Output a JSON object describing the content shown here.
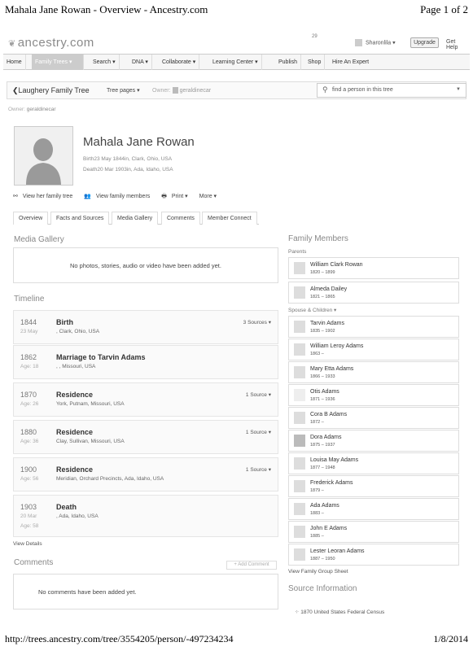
{
  "print": {
    "header_title": "Mahala Jane Rowan - Overview - Ancestry.com",
    "page_of": "Page 1 of 2",
    "footer_url": "http://trees.ancestry.com/tree/3554205/person/-497234234",
    "footer_date": "1/8/2014"
  },
  "topbar": {
    "logo": "ancestry.com",
    "notification_count": "29",
    "user": "Sharonlila ▾",
    "upgrade": "Upgrade",
    "help": "Get Help"
  },
  "nav": {
    "items": [
      "Home",
      "Family Trees ▾",
      "Search ▾",
      "DNA ▾",
      "Collaborate ▾",
      "Learning Center ▾",
      "Publish",
      "Shop",
      "Hire An Expert"
    ]
  },
  "treebar": {
    "back": "❮Laughery Family Tree",
    "tree_pages": "Tree pages ▾",
    "owner_label": "Owner:",
    "owner_name": "geraldinecar",
    "find_placeholder": "find a person in this tree"
  },
  "owner_line": {
    "label": "Owner:",
    "name": "geraldinecar"
  },
  "person": {
    "name": "Mahala Jane Rowan",
    "birth": "Birth23 May 1844in, Clark, Ohio, USA",
    "death": "Death20 Mar 1903in, Ada, Idaho, USA"
  },
  "actions": [
    "View her family tree",
    "View family members",
    "Print ▾",
    "More ▾"
  ],
  "tabs": [
    "Overview",
    "Facts and Sources",
    "Media Gallery",
    "Comments",
    "Member Connect"
  ],
  "media": {
    "title": "Media Gallery",
    "empty": "No photos, stories, audio or video have been added yet."
  },
  "timeline": {
    "title": "Timeline",
    "events": [
      {
        "year": "1844",
        "sub": "23 May",
        "event": "Birth",
        "place": ", Clark, Ohio, USA",
        "sources": "3 Sources ▾"
      },
      {
        "year": "1862",
        "sub": "Age: 18",
        "event": "Marriage to Tarvin Adams",
        "place": ", , Missouri, USA",
        "sources": ""
      },
      {
        "year": "1870",
        "sub": "Age: 26",
        "event": "Residence",
        "place": "York, Putnam, Missouri, USA",
        "sources": "1 Source ▾"
      },
      {
        "year": "1880",
        "sub": "Age: 36",
        "event": "Residence",
        "place": "Clay, Sullivan, Missouri, USA",
        "sources": "1 Source ▾"
      },
      {
        "year": "1900",
        "sub": "Age: 56",
        "event": "Residence",
        "place": "Meridian, Orchard Precincts, Ada, Idaho, USA",
        "sources": "1 Source ▾"
      },
      {
        "year": "1903",
        "sub": "20 Mar",
        "sub2": "Age: 58",
        "event": "Death",
        "place": ", Ada, Idaho, USA",
        "sources": ""
      }
    ],
    "view_details": "View Details"
  },
  "comments": {
    "title": "Comments",
    "add": "+ Add Comment",
    "empty": "No comments have been added yet."
  },
  "family": {
    "title": "Family Members",
    "parents_label": "Parents",
    "parents": [
      {
        "name": "William Clark Rowan",
        "dates": "1820 – 1899"
      },
      {
        "name": "Almeda Dailey",
        "dates": "1821 – 1865"
      }
    ],
    "spouse_label": "Spouse & Children ▾",
    "spouse_children": [
      {
        "name": "Tarvin Adams",
        "dates": "1835 – 1902"
      },
      {
        "name": "William Leroy Adams",
        "dates": "1863 –"
      },
      {
        "name": "Mary Etta Adams",
        "dates": "1866 – 1933"
      },
      {
        "name": "Otis Adams",
        "dates": "1871 – 1936"
      },
      {
        "name": "Cora B Adams",
        "dates": "1872 –"
      },
      {
        "name": "Dora Adams",
        "dates": "1875 – 1937"
      },
      {
        "name": "Louisa May Adams",
        "dates": "1877 – 1948"
      },
      {
        "name": "Frederick Adams",
        "dates": "1879 –"
      },
      {
        "name": "Ada Adams",
        "dates": "1883 –"
      },
      {
        "name": "John E Adams",
        "dates": "1885 –"
      },
      {
        "name": "Lester Leoran Adams",
        "dates": "1887 – 1950"
      }
    ],
    "group_sheet": "View Family Group Sheet"
  },
  "source_info": {
    "title": "Source Information",
    "first": "1870 United States Federal Census"
  }
}
